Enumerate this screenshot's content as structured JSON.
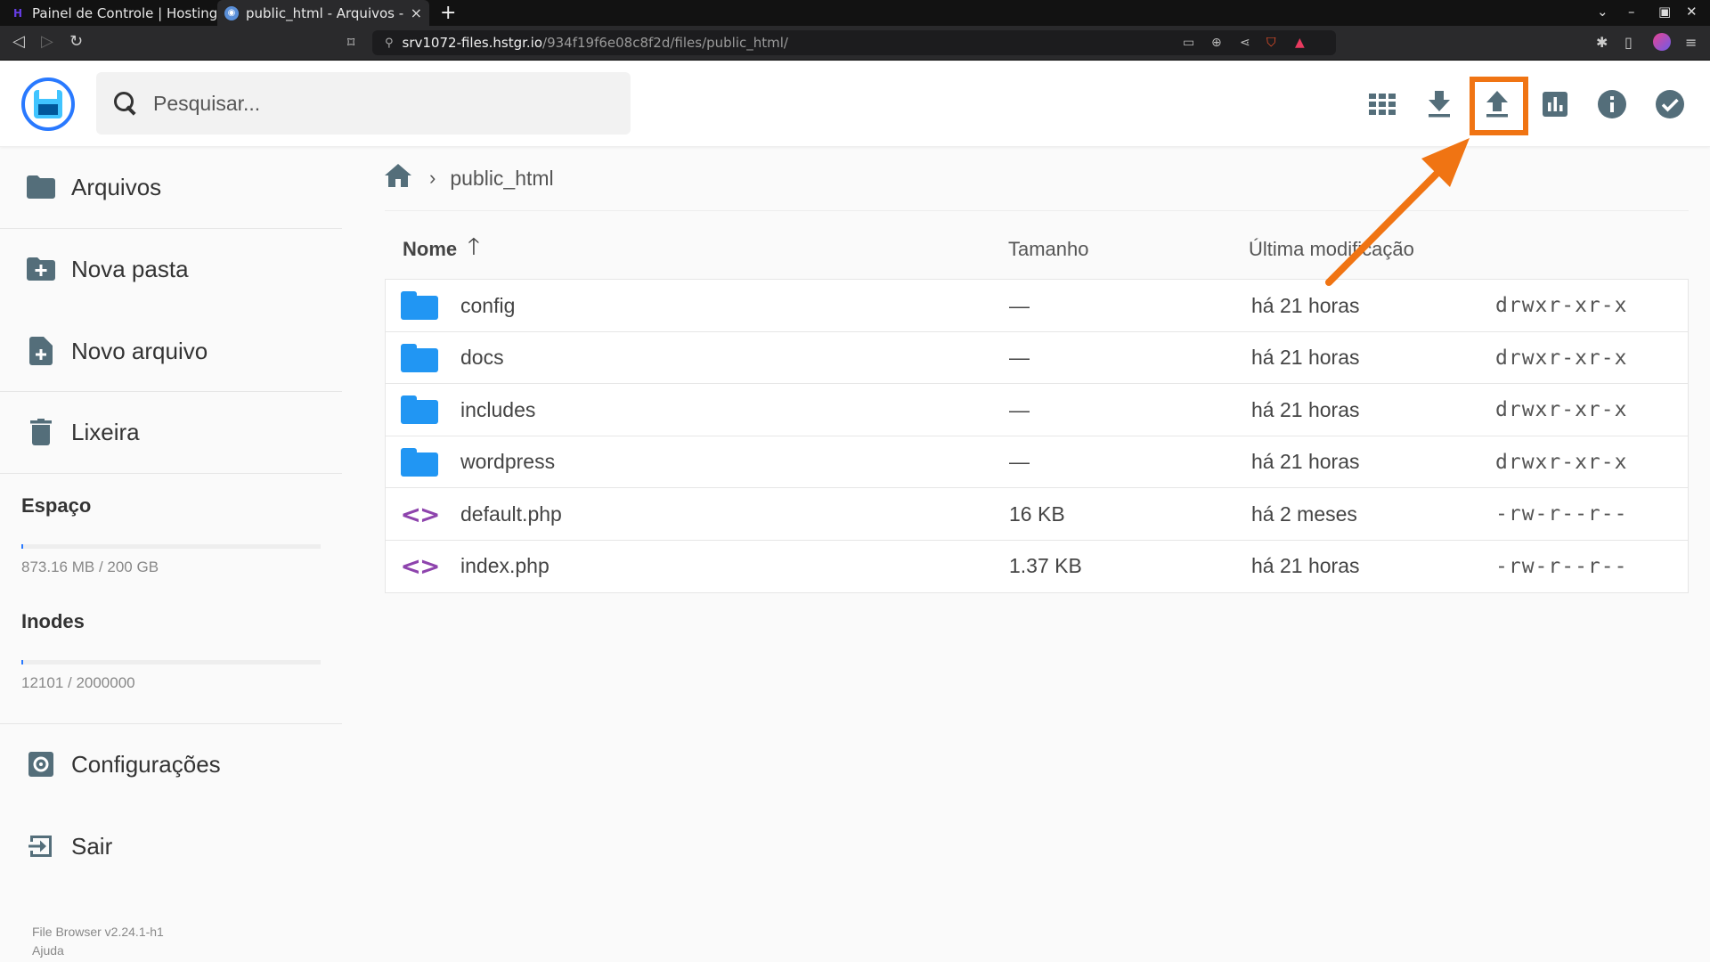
{
  "browser": {
    "tabs": [
      {
        "title": "Painel de Controle | Hostinger",
        "favicon": "hostinger-icon"
      },
      {
        "title": "public_html - Arquivos - Fi",
        "favicon": "globe-icon",
        "active": true
      }
    ],
    "url_host": "srv1072-files.hstgr.io",
    "url_path": "/934f19f6e08c8f2d/files/public_html/"
  },
  "header": {
    "search_placeholder": "Pesquisar...",
    "actions": [
      "grid-view-icon",
      "download-icon",
      "upload-icon",
      "chart-icon",
      "info-icon",
      "check-icon"
    ],
    "accent_color": "#2979ff",
    "highlight_color": "#f07413"
  },
  "sidebar": {
    "items": [
      {
        "label": "Arquivos",
        "icon": "folder-icon"
      },
      {
        "label": "Nova pasta",
        "icon": "new-folder-icon"
      },
      {
        "label": "Novo arquivo",
        "icon": "new-file-icon"
      },
      {
        "label": "Lixeira",
        "icon": "trash-icon"
      }
    ],
    "space_label": "Espaço",
    "space_value": "873.16 MB / 200 GB",
    "space_fraction": 0.0044,
    "inodes_label": "Inodes",
    "inodes_value": "12101 / 2000000",
    "inodes_fraction": 0.006,
    "settings_label": "Configurações",
    "logout_label": "Sair",
    "version": "File Browser v2.24.1-h1",
    "help": "Ajuda"
  },
  "breadcrumb": {
    "current": "public_html"
  },
  "list": {
    "columns": {
      "name": "Nome",
      "size": "Tamanho",
      "modified": "Última modificação"
    },
    "rows": [
      {
        "name": "config",
        "type": "folder",
        "size": "—",
        "modified": "há 21 horas",
        "perm": "drwxr-xr-x"
      },
      {
        "name": "docs",
        "type": "folder",
        "size": "—",
        "modified": "há 21 horas",
        "perm": "drwxr-xr-x"
      },
      {
        "name": "includes",
        "type": "folder",
        "size": "—",
        "modified": "há 21 horas",
        "perm": "drwxr-xr-x"
      },
      {
        "name": "wordpress",
        "type": "folder",
        "size": "—",
        "modified": "há 21 horas",
        "perm": "drwxr-xr-x"
      },
      {
        "name": "default.php",
        "type": "code",
        "size": "16 KB",
        "modified": "há 2 meses",
        "perm": "-rw-r--r--"
      },
      {
        "name": "index.php",
        "type": "code",
        "size": "1.37 KB",
        "modified": "há 21 horas",
        "perm": "-rw-r--r--"
      }
    ]
  }
}
